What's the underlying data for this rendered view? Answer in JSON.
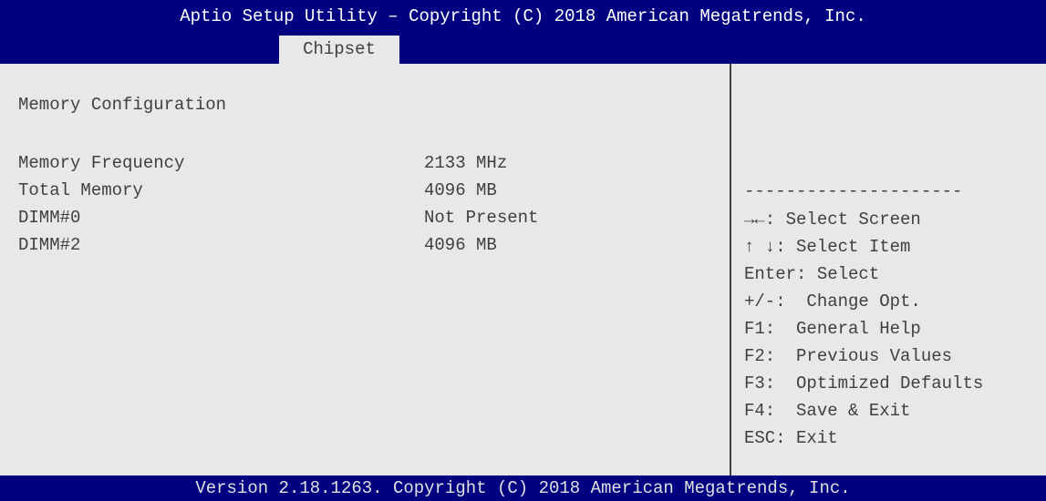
{
  "header": {
    "title": "Aptio Setup Utility – Copyright (C) 2018 American Megatrends, Inc.",
    "active_tab": "Chipset"
  },
  "main": {
    "section_title": "Memory Configuration",
    "rows": [
      {
        "label": "Memory Frequency",
        "value": "2133 MHz"
      },
      {
        "label": "Total Memory",
        "value": "4096 MB"
      },
      {
        "label": "DIMM#0",
        "value": "Not Present"
      },
      {
        "label": "DIMM#2",
        "value": "4096 MB"
      }
    ]
  },
  "help": {
    "separator": "---------------------",
    "keys": [
      "→←: Select Screen",
      "↑ ↓: Select Item",
      "Enter: Select",
      "+/-:  Change Opt.",
      "F1:  General Help",
      "F2:  Previous Values",
      "F3:  Optimized Defaults",
      "F4:  Save & Exit",
      "ESC: Exit"
    ]
  },
  "footer": {
    "text": "Version 2.18.1263. Copyright (C) 2018 American Megatrends, Inc."
  },
  "colors": {
    "bar_background": "#000080",
    "panel_background": "#e8e8e8",
    "text": "#404040",
    "bar_text": "#ffffff"
  }
}
